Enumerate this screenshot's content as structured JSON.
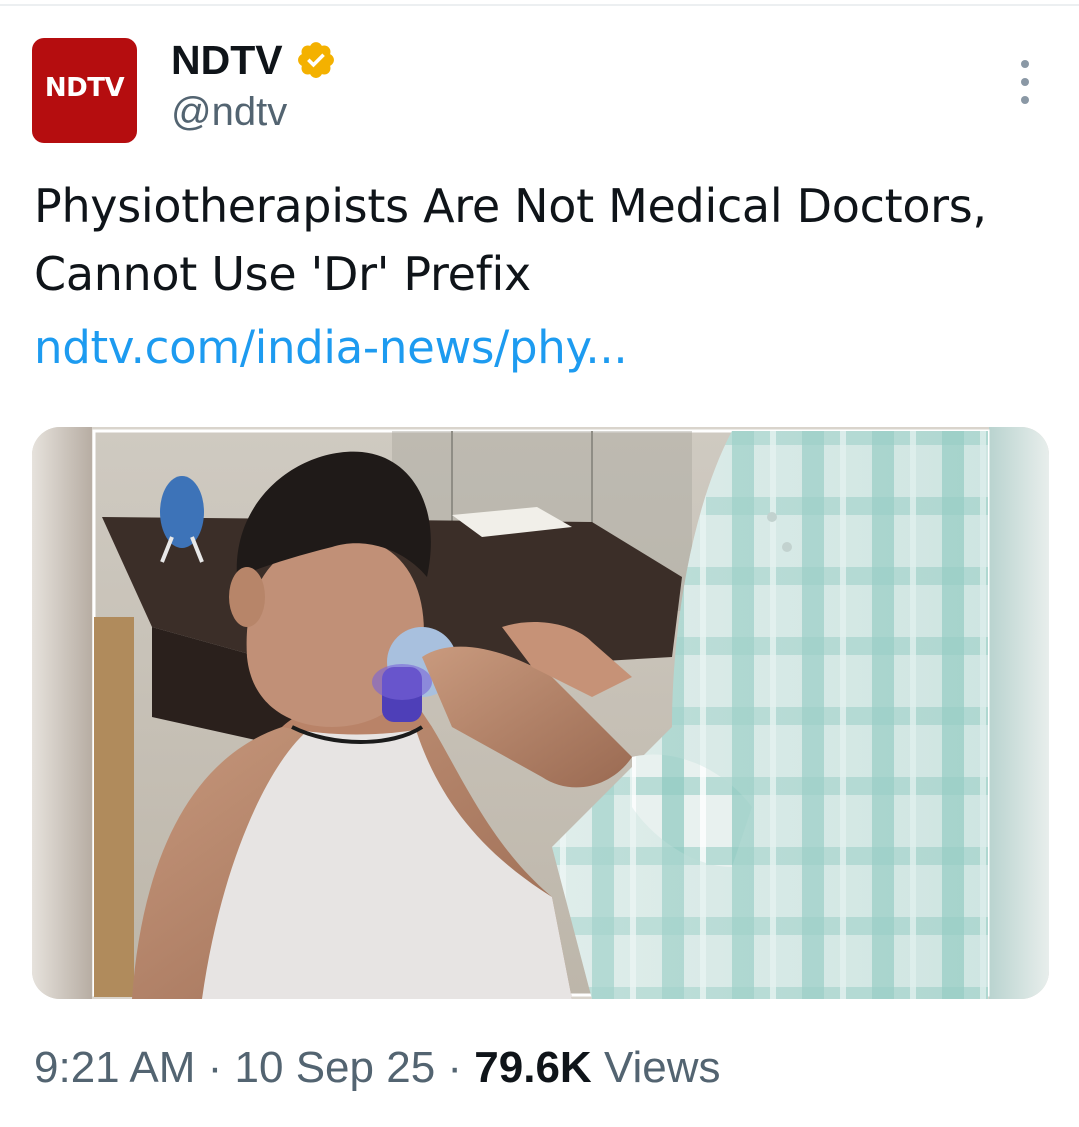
{
  "author": {
    "display_name": "NDTV",
    "handle": "@ndtv",
    "avatar_text": "NDTV",
    "verified_icon": "verified-badge-icon",
    "verified_color": "#f4b100"
  },
  "tweet": {
    "text": "Physiotherapists Are Not Medical Doctors, Cannot Use 'Dr' Prefix",
    "link": "ndtv.com/india-news/phy..."
  },
  "meta": {
    "time": "9:21 AM",
    "date": "10 Sep 25",
    "separator": " · ",
    "views_count": "79.6K",
    "views_label": "Views"
  },
  "colors": {
    "text_primary": "#0f1419",
    "text_secondary": "#536471",
    "link": "#1d9bf0",
    "avatar_bg": "#b50d0f"
  },
  "icons": {
    "more": "more-options-icon"
  }
}
